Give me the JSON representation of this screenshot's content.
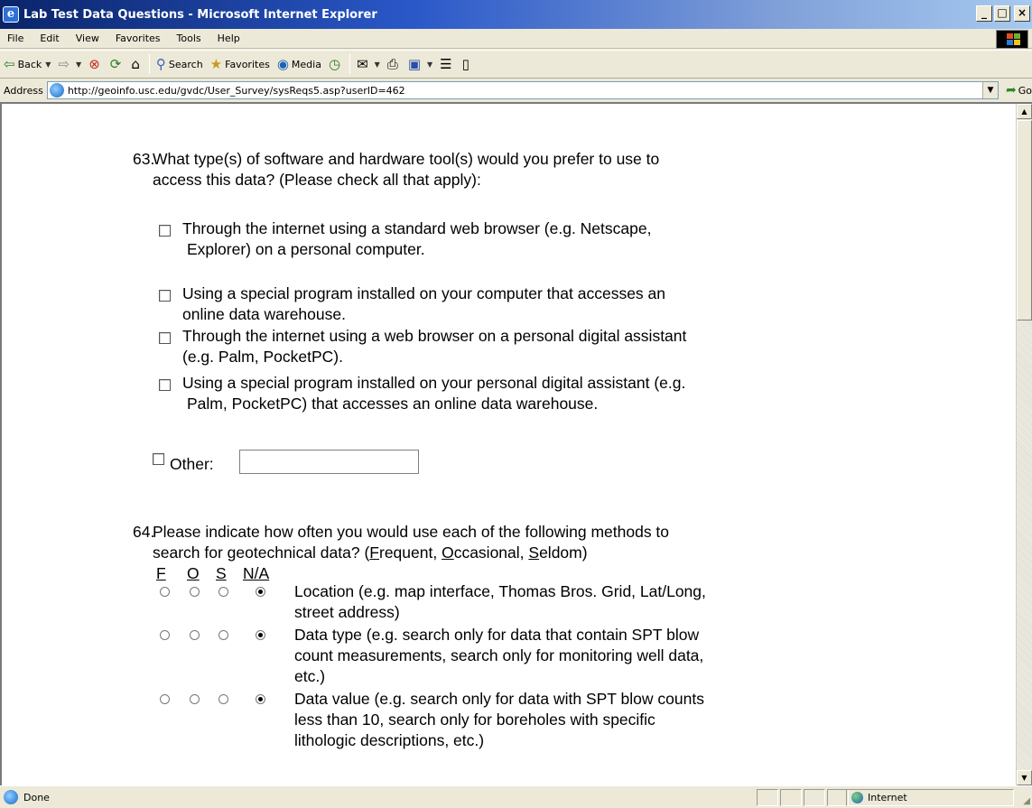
{
  "window": {
    "title": "Lab Test Data Questions - Microsoft Internet Explorer",
    "buttons": {
      "minimize": "_",
      "maximize": "□",
      "close": "×"
    }
  },
  "menu": [
    "File",
    "Edit",
    "View",
    "Favorites",
    "Tools",
    "Help"
  ],
  "toolbar": {
    "back": "Back",
    "search": "Search",
    "favorites": "Favorites",
    "media": "Media"
  },
  "address": {
    "label": "Address",
    "url": "http://geoinfo.usc.edu/gvdc/User_Survey/sysReqs5.asp?userID=462",
    "go": "Go"
  },
  "q63": {
    "number": "63.",
    "line1": "What type(s) of software and hardware tool(s) would you prefer to use to",
    "line2": "access this data? (Please check all that apply):",
    "options": [
      {
        "line1": "Through the internet using a standard web browser (e.g. Netscape,",
        "line2": "Explorer) on a personal computer."
      },
      {
        "line1": "Using a special program installed on your computer that accesses an",
        "line2": "online data warehouse."
      },
      {
        "line1": "Through the internet using a web browser on a personal digital assistant",
        "line2": "(e.g. Palm, PocketPC)."
      },
      {
        "line1": "Using a special program installed on your personal digital assistant (e.g.",
        "line2": "Palm, PocketPC) that accesses an online data warehouse."
      }
    ],
    "other_label": "Other:",
    "other_value": ""
  },
  "q64": {
    "number": "64.",
    "line1": "Please indicate how often you would use each of the following methods to",
    "line2_a": "search for geotechnical data? (",
    "f_key": "F",
    "f_rest": "requent, ",
    "o_key": "O",
    "o_rest": "ccasional, ",
    "s_key": "S",
    "s_rest": "eldom)",
    "columns": [
      "F",
      "O",
      "S",
      "N/A"
    ],
    "rows": [
      {
        "lines": [
          "Location (e.g. map interface, Thomas Bros. Grid, Lat/Long,",
          "street address)"
        ],
        "selected": "N/A"
      },
      {
        "lines": [
          "Data type (e.g. search only for data that contain SPT blow",
          "count measurements, search only for monitoring well data,",
          "etc.)"
        ],
        "selected": "N/A"
      },
      {
        "lines": [
          "Data value (e.g. search only for data with SPT blow counts",
          "less  than 10, search only for boreholes with specific",
          "lithologic descriptions, etc.)"
        ],
        "selected": "N/A"
      }
    ]
  },
  "status": {
    "text": "Done",
    "zone": "Internet"
  }
}
